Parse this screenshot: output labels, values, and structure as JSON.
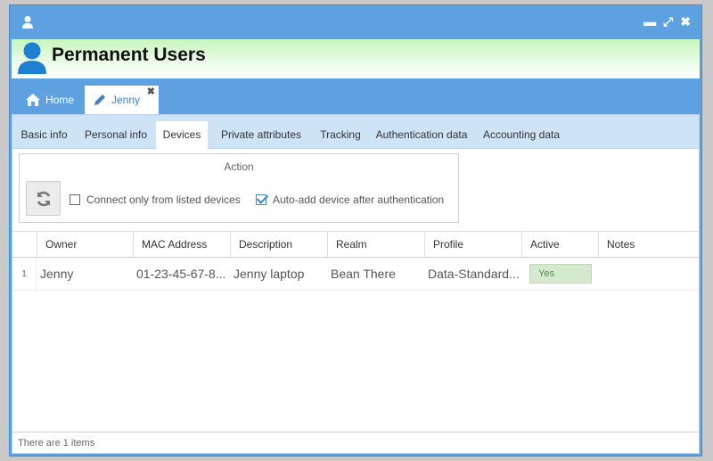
{
  "window": {
    "controls": {
      "minimize": "▬",
      "maximize": "⤢",
      "close": "✖"
    }
  },
  "header": {
    "title": "Permanent Users"
  },
  "tabs": [
    {
      "label": "Home",
      "icon": "home-icon"
    },
    {
      "label": "Jenny",
      "icon": "pencil-icon",
      "close": "✖"
    }
  ],
  "subtabs": [
    {
      "label": "Basic info"
    },
    {
      "label": "Personal info"
    },
    {
      "label": "Devices",
      "active": true
    },
    {
      "label": "Private attributes"
    },
    {
      "label": "Tracking"
    },
    {
      "label": "Authentication data"
    },
    {
      "label": "Accounting data"
    }
  ],
  "action": {
    "title": "Action",
    "refresh_icon": "refresh-icon",
    "connect_only_label": "Connect only from listed devices",
    "connect_only_checked": false,
    "auto_add_label": "Auto-add device after authentication",
    "auto_add_checked": true
  },
  "grid": {
    "columns": [
      "Owner",
      "MAC Address",
      "Description",
      "Realm",
      "Profile",
      "Active",
      "Notes"
    ],
    "rows": [
      {
        "num": "1",
        "owner": "Jenny",
        "mac": "01-23-45-67-8...",
        "description": "Jenny laptop",
        "realm": "Bean There",
        "profile": "Data-Standard...",
        "active": "Yes",
        "notes": ""
      }
    ]
  },
  "footer": {
    "status": "There are 1 items"
  },
  "colors": {
    "titlebar": "#5da1e0",
    "subtab_bar": "#cfe3f7",
    "active_badge": "#d5e8d0",
    "accent": "#3b87c8"
  }
}
